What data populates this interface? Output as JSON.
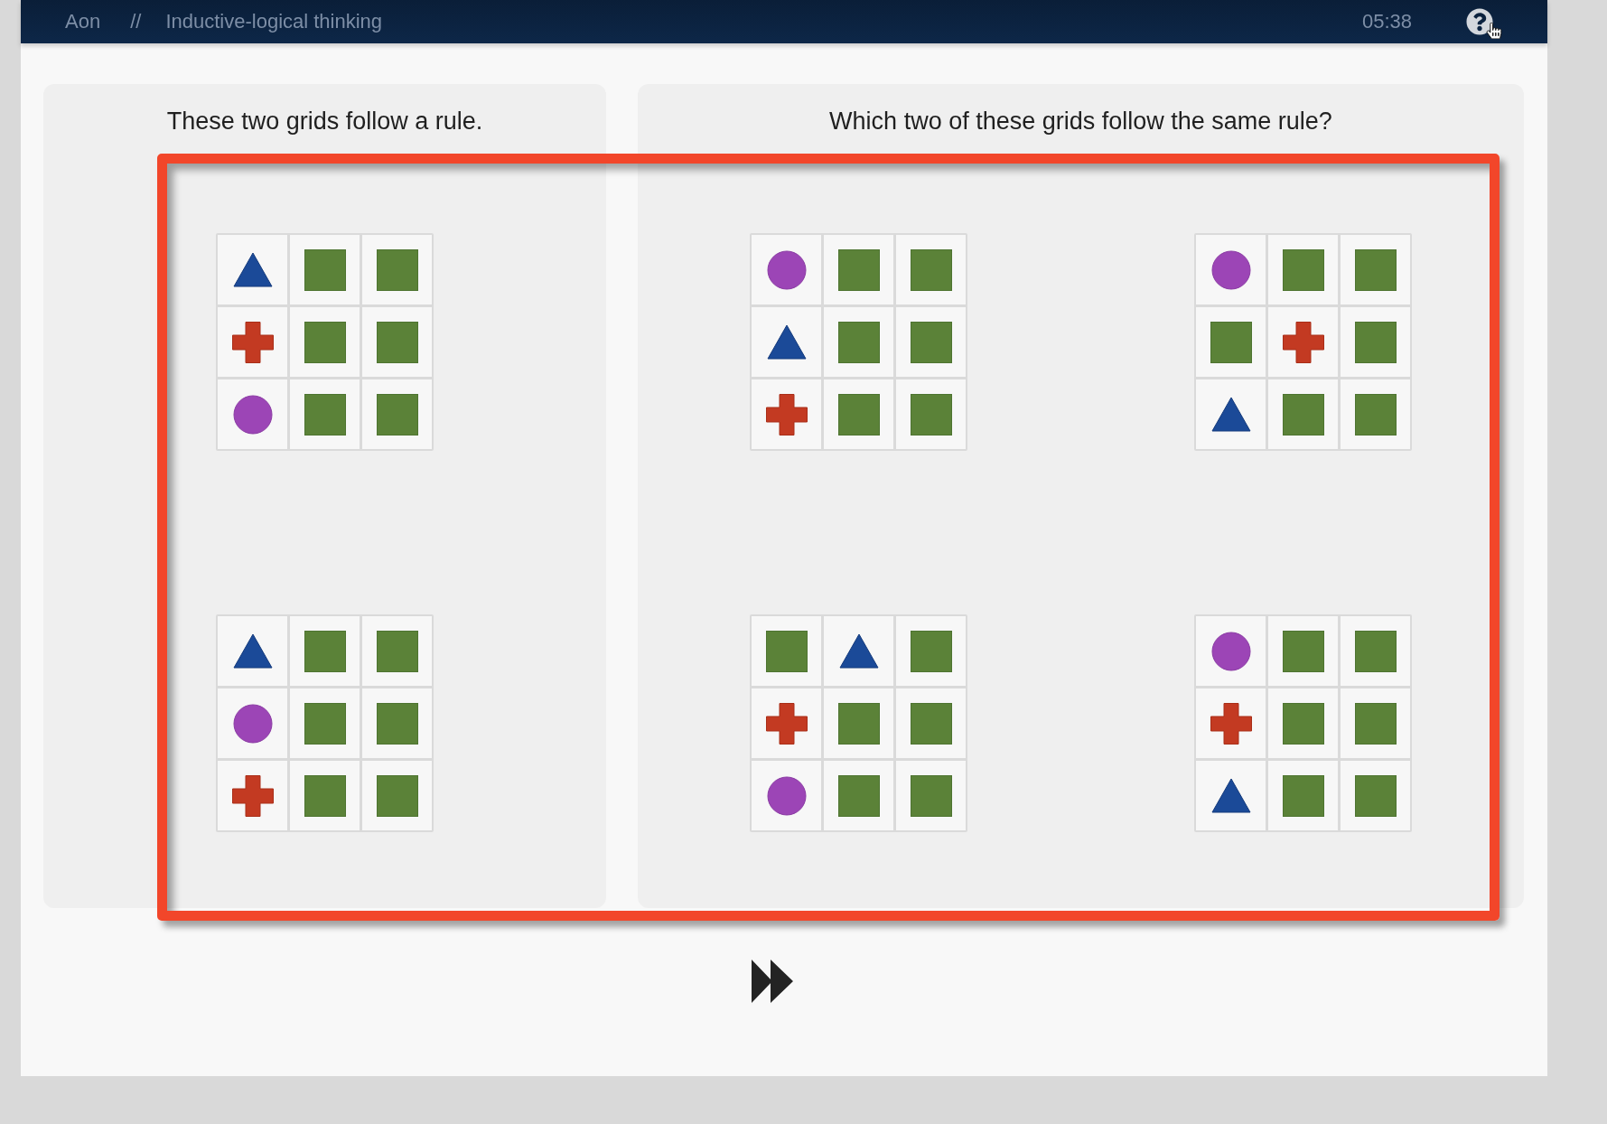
{
  "header": {
    "brand": "Aon",
    "separator": "//",
    "title": "Inductive-logical thinking",
    "timer": "05:38"
  },
  "example_panel": {
    "title": "These two grids follow a rule.",
    "grids": [
      {
        "cells": [
          {
            "kind": "triangle"
          },
          {
            "kind": "square"
          },
          {
            "kind": "square"
          },
          {
            "kind": "cross"
          },
          {
            "kind": "square"
          },
          {
            "kind": "square"
          },
          {
            "kind": "circle"
          },
          {
            "kind": "square"
          },
          {
            "kind": "square"
          }
        ]
      },
      {
        "cells": [
          {
            "kind": "triangle"
          },
          {
            "kind": "square"
          },
          {
            "kind": "square"
          },
          {
            "kind": "circle"
          },
          {
            "kind": "square"
          },
          {
            "kind": "square"
          },
          {
            "kind": "cross"
          },
          {
            "kind": "square"
          },
          {
            "kind": "square"
          }
        ]
      }
    ]
  },
  "answer_panel": {
    "title": "Which two of these grids follow the same rule?",
    "grids": [
      {
        "cells": [
          {
            "kind": "circle"
          },
          {
            "kind": "square"
          },
          {
            "kind": "square"
          },
          {
            "kind": "triangle"
          },
          {
            "kind": "square"
          },
          {
            "kind": "square"
          },
          {
            "kind": "cross"
          },
          {
            "kind": "square"
          },
          {
            "kind": "square"
          }
        ]
      },
      {
        "cells": [
          {
            "kind": "circle"
          },
          {
            "kind": "square"
          },
          {
            "kind": "square"
          },
          {
            "kind": "square"
          },
          {
            "kind": "cross"
          },
          {
            "kind": "square"
          },
          {
            "kind": "triangle"
          },
          {
            "kind": "square"
          },
          {
            "kind": "square"
          }
        ]
      },
      {
        "cells": [
          {
            "kind": "square"
          },
          {
            "kind": "triangle"
          },
          {
            "kind": "square"
          },
          {
            "kind": "cross"
          },
          {
            "kind": "square"
          },
          {
            "kind": "square"
          },
          {
            "kind": "circle"
          },
          {
            "kind": "square"
          },
          {
            "kind": "square"
          }
        ]
      },
      {
        "cells": [
          {
            "kind": "circle"
          },
          {
            "kind": "square"
          },
          {
            "kind": "square"
          },
          {
            "kind": "cross"
          },
          {
            "kind": "square"
          },
          {
            "kind": "square"
          },
          {
            "kind": "triangle"
          },
          {
            "kind": "square"
          },
          {
            "kind": "square"
          }
        ]
      }
    ]
  }
}
